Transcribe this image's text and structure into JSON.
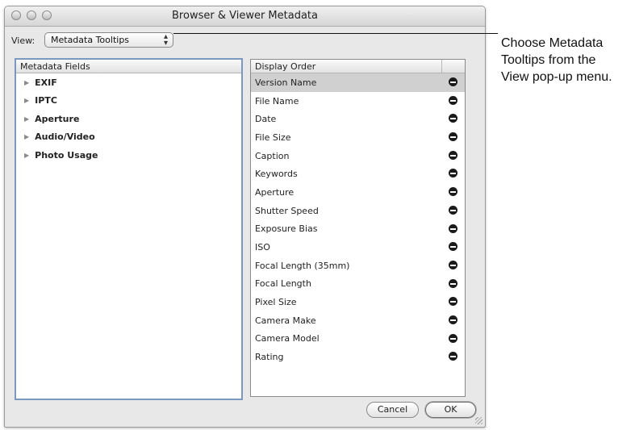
{
  "window": {
    "title": "Browser & Viewer Metadata"
  },
  "view": {
    "label": "View:",
    "selected": "Metadata Tooltips"
  },
  "metadata_fields": {
    "header": "Metadata Fields",
    "items": [
      "EXIF",
      "IPTC",
      "Aperture",
      "Audio/Video",
      "Photo Usage"
    ]
  },
  "display_order": {
    "header": "Display Order",
    "items": [
      "Version Name",
      "File Name",
      "Date",
      "File Size",
      "Caption",
      "Keywords",
      "Aperture",
      "Shutter Speed",
      "Exposure Bias",
      "ISO",
      "Focal Length (35mm)",
      "Focal Length",
      "Pixel Size",
      "Camera Make",
      "Camera Model",
      "Rating"
    ],
    "selected_index": 0
  },
  "buttons": {
    "cancel": "Cancel",
    "ok": "OK"
  },
  "callout": {
    "lines": [
      "Choose Metadata",
      "Tooltips from the",
      "View pop-up menu."
    ]
  }
}
